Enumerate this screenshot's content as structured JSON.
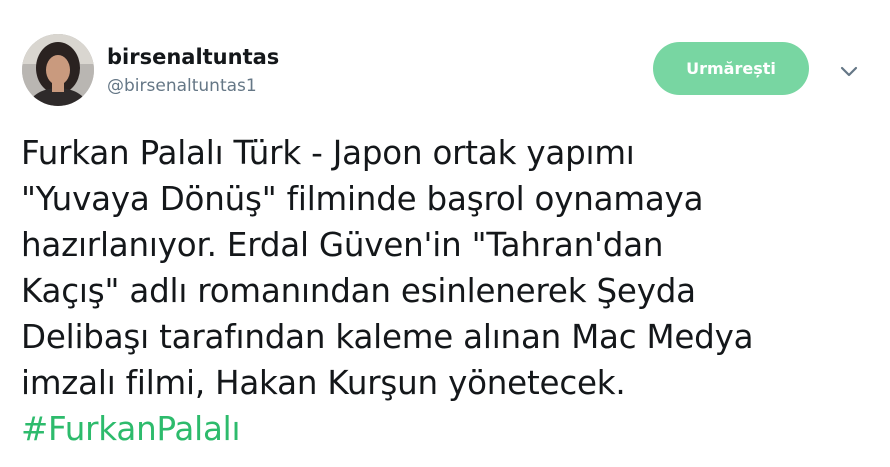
{
  "user": {
    "display_name": "birsenaltuntas",
    "handle": "@birsenaltuntas1"
  },
  "follow_button": {
    "label": "Urmărești"
  },
  "tweet": {
    "lines": [
      "Furkan Palalı Türk - Japon ortak yapımı",
      "\"Yuvaya Dönüş\" filminde başrol oynamaya",
      "hazırlanıyor. Erdal Güven'in \"Tahran'dan",
      "Kaçış\" adlı romanından esinlenerek Şeyda",
      "Delibaşı tarafından kaleme alınan Mac Medya",
      "imzalı filmi, Hakan Kurşun yönetecek."
    ],
    "hashtag": "#FurkanPalalı"
  },
  "colors": {
    "follow_button_bg": "#78d6a2",
    "hashtag": "#2dbb6c",
    "handle": "#657786",
    "text": "#14171a"
  },
  "icons": {
    "caret": "chevron-down-icon",
    "avatar": "profile-photo"
  }
}
